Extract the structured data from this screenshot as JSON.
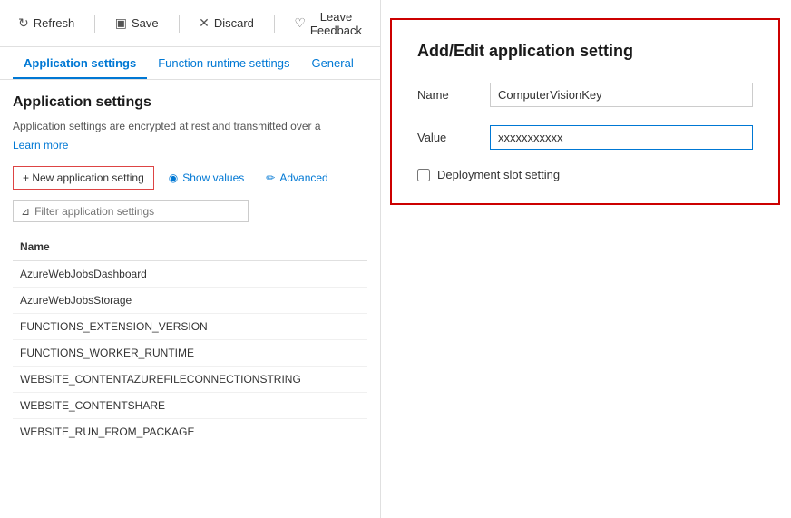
{
  "toolbar": {
    "refresh_label": "Refresh",
    "save_label": "Save",
    "discard_label": "Discard",
    "feedback_label": "Leave Feedback"
  },
  "tabs": [
    {
      "id": "app-settings",
      "label": "Application settings",
      "active": true
    },
    {
      "id": "func-runtime",
      "label": "Function runtime settings",
      "active": false
    },
    {
      "id": "general",
      "label": "General",
      "active": false
    }
  ],
  "section": {
    "title": "Application settings",
    "description": "Application settings are encrypted at rest and transmitted over a",
    "learn_more": "Learn more"
  },
  "actions": {
    "new_setting": "+ New application setting",
    "show_values": "Show values",
    "advanced": "Advanced"
  },
  "filter": {
    "placeholder": "Filter application settings"
  },
  "table": {
    "column_name": "Name",
    "rows": [
      {
        "name": "AzureWebJobsDashboard"
      },
      {
        "name": "AzureWebJobsStorage"
      },
      {
        "name": "FUNCTIONS_EXTENSION_VERSION"
      },
      {
        "name": "FUNCTIONS_WORKER_RUNTIME"
      },
      {
        "name": "WEBSITE_CONTENTAZUREFILECONNECTIONSTRING"
      },
      {
        "name": "WEBSITE_CONTENTSHARE"
      },
      {
        "name": "WEBSITE_RUN_FROM_PACKAGE"
      }
    ]
  },
  "dialog": {
    "title": "Add/Edit application setting",
    "name_label": "Name",
    "name_value": "ComputerVisionKey",
    "value_label": "Value",
    "value_value": "xxxxxxxxxxx",
    "checkbox_label": "Deployment slot setting",
    "checkbox_checked": false
  },
  "icons": {
    "refresh": "↻",
    "save": "💾",
    "discard": "✕",
    "feedback": "♡",
    "filter": "⊿",
    "show_values": "◉",
    "advanced": "✏",
    "plus": "+"
  }
}
